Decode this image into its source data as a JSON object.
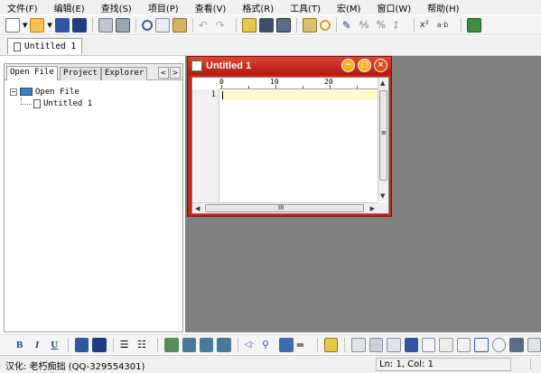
{
  "menu": [
    "文件(F)",
    "编辑(E)",
    "查找(S)",
    "项目(P)",
    "查看(V)",
    "格式(R)",
    "工具(T)",
    "宏(M)",
    "窗口(W)",
    "帮助(H)"
  ],
  "document_tab": "Untitled 1",
  "panel": {
    "tabs": [
      "Open File",
      "Project",
      "Explorer"
    ],
    "arrows": [
      "<",
      ">"
    ],
    "tree_root": "Open File",
    "tree_child": "Untitled 1",
    "expander": "−"
  },
  "editor_window": {
    "title": "Untitled 1",
    "controls": [
      "−",
      "□",
      "×"
    ],
    "ruler_labels": [
      "0",
      "10",
      "20"
    ],
    "line_number": "1",
    "hscroll_label": "III",
    "vscroll_label": "≡"
  },
  "bottom_toolbar": [
    "B",
    "I",
    "U"
  ],
  "status": {
    "left": "汉化: 老朽痴拙 (QQ-329554301)",
    "position": "Ln: 1, Col: 1"
  },
  "icons": {
    "toolbar": [
      "new-file-icon",
      "dropdown-arrow-icon",
      "open-folder-icon",
      "dropdown-arrow-icon",
      "save-icon",
      "save-all-icon",
      "print-icon",
      "print-preview-icon",
      "cut-icon",
      "copy-icon",
      "paste-icon",
      "undo-icon",
      "redo-icon",
      "find-icon",
      "replace-icon",
      "calculator-icon",
      "find-in-files-icon",
      "search-icon",
      "pen-icon",
      "cursor-icon",
      "percent-icon",
      "comment-icon",
      "spell-check-icon",
      "ab-icon",
      "macro-icon"
    ],
    "bottom_toolbar": [
      "color-icon",
      "highlight-icon",
      "bullet-list-icon",
      "numbered-list-icon",
      "align-left-icon",
      "align-center-icon",
      "align-right-icon",
      "align-justify-icon",
      "tag-icon",
      "link-icon",
      "anchor-icon",
      "hr-icon",
      "image-icon",
      "table-icon",
      "form-icon",
      "frame-icon",
      "checkbox-icon",
      "radio-icon",
      "text-field-icon",
      "select-icon"
    ]
  },
  "colors": {
    "accent": "#c1261f",
    "mdi_background": "#808080",
    "current_line": "#fffac8"
  }
}
